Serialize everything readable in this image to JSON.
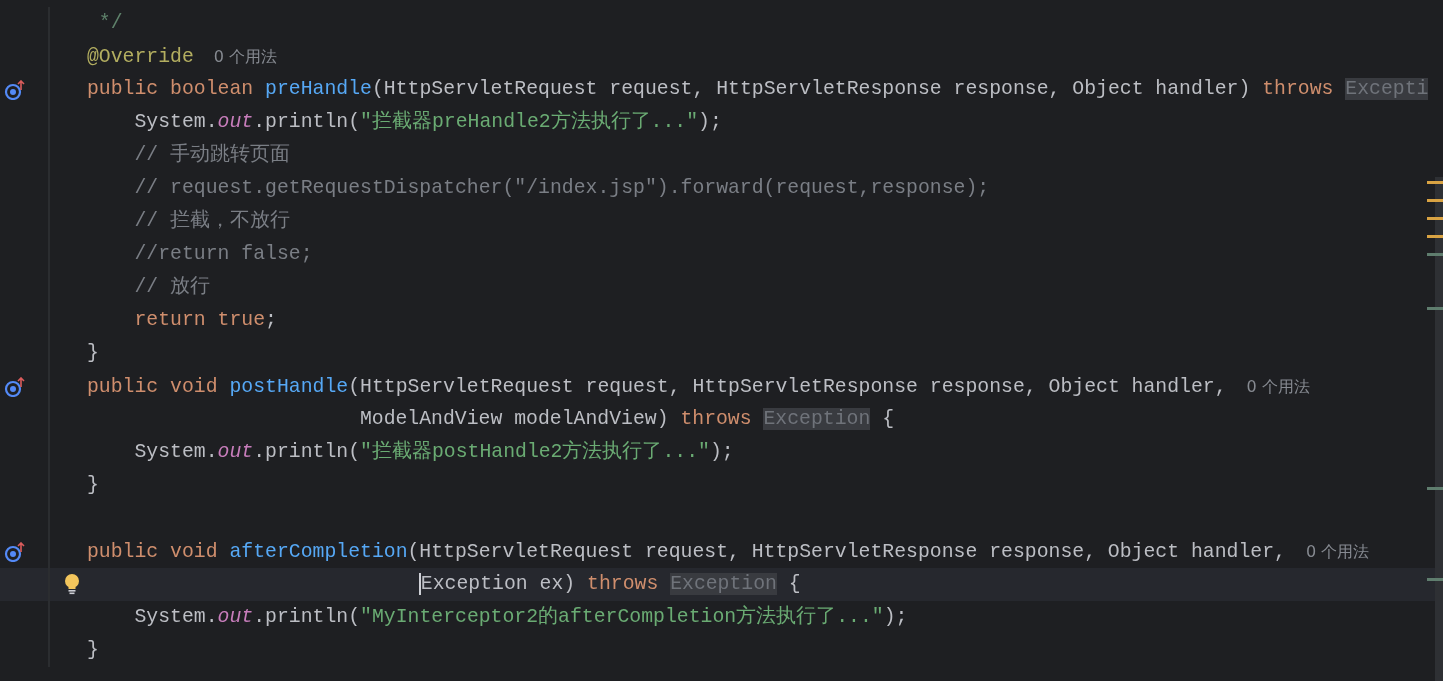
{
  "editor": {
    "lines": [
      {
        "tokens": [
          {
            "kind": "doc",
            "text": "*/",
            "space_before": true
          }
        ]
      },
      {
        "tokens": [
          {
            "kind": "annotation",
            "text": "@Override"
          },
          {
            "kind": "hint",
            "text": "0 个用法"
          }
        ]
      },
      {
        "override_marker": true,
        "tokens": [
          {
            "kind": "keyword",
            "text": "public boolean"
          },
          {
            "kind": "method",
            "text": "preHandle",
            "space_before": true
          },
          {
            "kind": "plain",
            "text": "(HttpServletRequest request, HttpServletResponse response, Object handler)"
          },
          {
            "kind": "keyword",
            "text": "throws",
            "space_before": true
          },
          {
            "kind": "exception",
            "text": "Excepti",
            "space_before": true
          }
        ]
      },
      {
        "indented": true,
        "tokens": [
          {
            "kind": "plain",
            "text": "System."
          },
          {
            "kind": "static",
            "text": "out"
          },
          {
            "kind": "plain",
            "text": ".println("
          },
          {
            "kind": "string",
            "text": "\"拦截器preHandle2方法执行了...\""
          },
          {
            "kind": "plain",
            "text": ");"
          }
        ]
      },
      {
        "indented": true,
        "tokens": [
          {
            "kind": "comment",
            "text": "// 手动跳转页面"
          }
        ]
      },
      {
        "indented": true,
        "tokens": [
          {
            "kind": "comment",
            "text": "// request.getRequestDispatcher(\"/index.jsp\").forward(request,response);"
          }
        ]
      },
      {
        "indented": true,
        "tokens": [
          {
            "kind": "comment",
            "text": "// 拦截，不放行"
          }
        ]
      },
      {
        "indented": true,
        "tokens": [
          {
            "kind": "comment",
            "text": "//return false;"
          }
        ]
      },
      {
        "indented": true,
        "tokens": [
          {
            "kind": "comment",
            "text": "// 放行"
          }
        ]
      },
      {
        "indented": true,
        "tokens": [
          {
            "kind": "keyword",
            "text": "return true"
          },
          {
            "kind": "plain",
            "text": ";"
          }
        ]
      },
      {
        "tokens": [
          {
            "kind": "plain",
            "text": "}"
          }
        ]
      },
      {
        "override_marker": true,
        "tokens": [
          {
            "kind": "keyword",
            "text": "public void"
          },
          {
            "kind": "method",
            "text": "postHandle",
            "space_before": true
          },
          {
            "kind": "plain",
            "text": "(HttpServletRequest request, HttpServletResponse response, Object handler,"
          },
          {
            "kind": "hint",
            "text": "0 个用法"
          }
        ]
      },
      {
        "wrapped": true,
        "tokens": [
          {
            "kind": "plain",
            "text": "ModelAndView modelAndView)"
          },
          {
            "kind": "keyword",
            "text": "throws",
            "space_before": true
          },
          {
            "kind": "exception",
            "text": "Exception",
            "space_before": true
          },
          {
            "kind": "plain",
            "text": "{",
            "space_before": true
          }
        ]
      },
      {
        "indented": true,
        "tokens": [
          {
            "kind": "plain",
            "text": "System."
          },
          {
            "kind": "static",
            "text": "out"
          },
          {
            "kind": "plain",
            "text": ".println("
          },
          {
            "kind": "string",
            "text": "\"拦截器postHandle2方法执行了...\""
          },
          {
            "kind": "plain",
            "text": ");"
          }
        ]
      },
      {
        "tokens": [
          {
            "kind": "plain",
            "text": "}"
          }
        ]
      },
      {
        "blank_before": true,
        "override_marker": true,
        "tokens": [
          {
            "kind": "keyword",
            "text": "public void"
          },
          {
            "kind": "method",
            "text": "afterCompletion",
            "space_before": true
          },
          {
            "kind": "plain",
            "text": "(HttpServletRequest request, HttpServletResponse response, Object handler,"
          },
          {
            "kind": "hint",
            "text": "0 个用法"
          }
        ]
      },
      {
        "wrapped": true,
        "bulb": true,
        "current": true,
        "caret": true,
        "tokens": [
          {
            "kind": "plain",
            "text": "Exception ex)"
          },
          {
            "kind": "keyword",
            "text": "throws",
            "space_before": true
          },
          {
            "kind": "exception",
            "text": "Exception",
            "space_before": true
          },
          {
            "kind": "plain",
            "text": "{",
            "space_before": true
          }
        ]
      },
      {
        "indented": true,
        "tokens": [
          {
            "kind": "plain",
            "text": "System."
          },
          {
            "kind": "static",
            "text": "out"
          },
          {
            "kind": "plain",
            "text": ".println("
          },
          {
            "kind": "string",
            "text": "\"MyInterceptor2的afterCompletion方法执行了...\""
          },
          {
            "kind": "plain",
            "text": ");"
          }
        ]
      },
      {
        "tokens": [
          {
            "kind": "plain",
            "text": "}"
          }
        ]
      }
    ],
    "error_stripe": [
      {
        "color": "#d9a343"
      },
      {
        "color": "#d9a343"
      },
      {
        "color": "#d9a343"
      },
      {
        "color": "#d9a343"
      },
      {
        "color": "#5f7d6e"
      },
      {
        "color": "#5f7d6e"
      },
      {
        "color": "#5f7d6e"
      },
      {
        "color": "#5f7d6e"
      }
    ]
  }
}
